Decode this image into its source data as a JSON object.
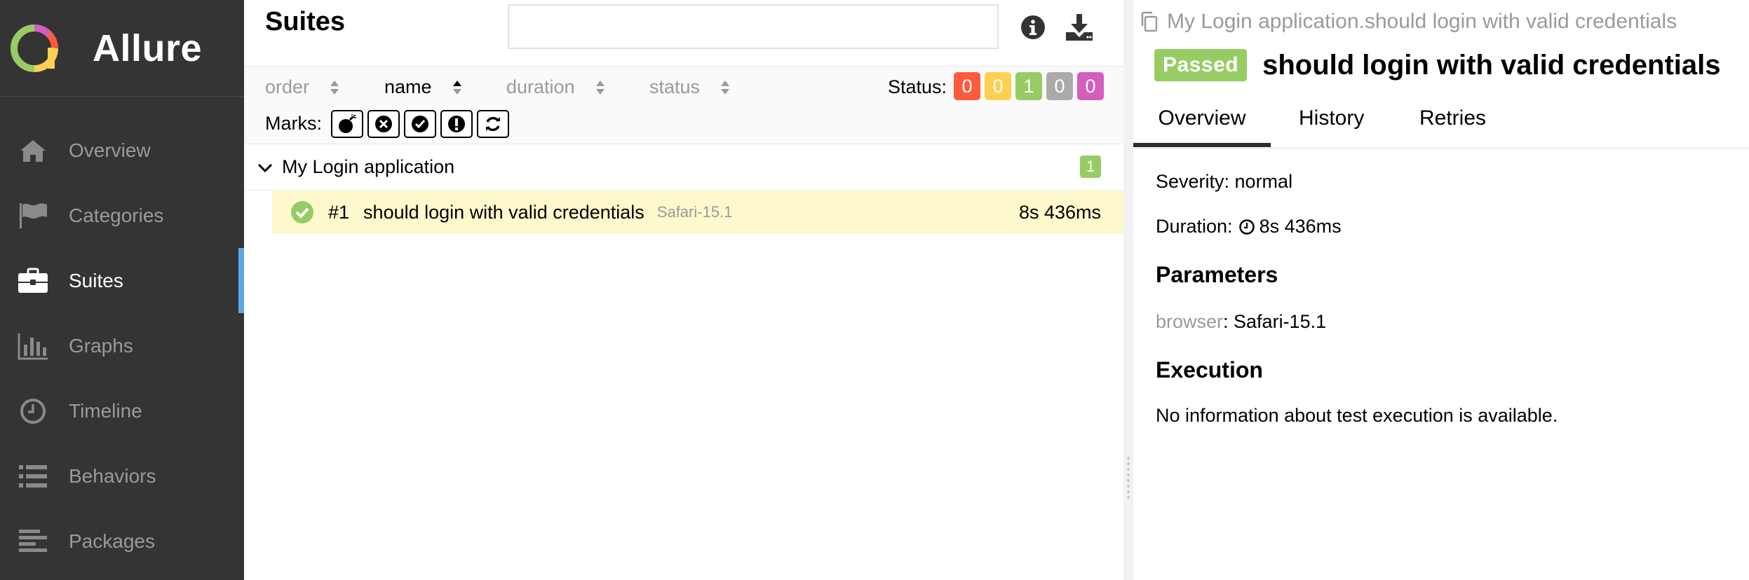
{
  "brand": {
    "name": "Allure"
  },
  "sidebar": {
    "items": [
      {
        "label": "Overview",
        "icon": "home-icon"
      },
      {
        "label": "Categories",
        "icon": "flag-icon"
      },
      {
        "label": "Suites",
        "icon": "briefcase-icon",
        "active": true
      },
      {
        "label": "Graphs",
        "icon": "bar-chart-icon"
      },
      {
        "label": "Timeline",
        "icon": "clock-icon"
      },
      {
        "label": "Behaviors",
        "icon": "list-icon"
      },
      {
        "label": "Packages",
        "icon": "align-left-icon"
      }
    ]
  },
  "suites": {
    "title": "Suites",
    "search": {
      "placeholder": "",
      "value": ""
    },
    "sort": {
      "order": "order",
      "name": "name",
      "duration": "duration",
      "status": "status"
    },
    "status_label": "Status:",
    "status_counts": [
      {
        "value": "0",
        "color": "#fd5a3e"
      },
      {
        "value": "0",
        "color": "#ffd050"
      },
      {
        "value": "1",
        "color": "#97cc64"
      },
      {
        "value": "0",
        "color": "#aaaaaa"
      },
      {
        "value": "0",
        "color": "#d35ebe"
      }
    ],
    "marks_label": "Marks:",
    "group": {
      "name": "My Login application",
      "count": "1"
    },
    "row": {
      "number": "#1",
      "name": "should login with valid credentials",
      "param": "Safari-15.1",
      "duration": "8s 436ms"
    }
  },
  "detail": {
    "breadcrumb": "My Login application.should login with valid credentials",
    "status": "Passed",
    "title": "should login with valid credentials",
    "tabs": [
      "Overview",
      "History",
      "Retries"
    ],
    "severity": "Severity: normal",
    "duration_label": "Duration:",
    "duration_value": "8s 436ms",
    "parameters_heading": "Parameters",
    "param_key": "browser",
    "param_value": ": Safari-15.1",
    "execution_heading": "Execution",
    "execution_text": "No information about test execution is available."
  },
  "colors": {
    "sidebar_bg": "#343434",
    "accent": "#5fa8e8",
    "passed": "#97cc64",
    "row_highlight": "#fef9cd"
  }
}
